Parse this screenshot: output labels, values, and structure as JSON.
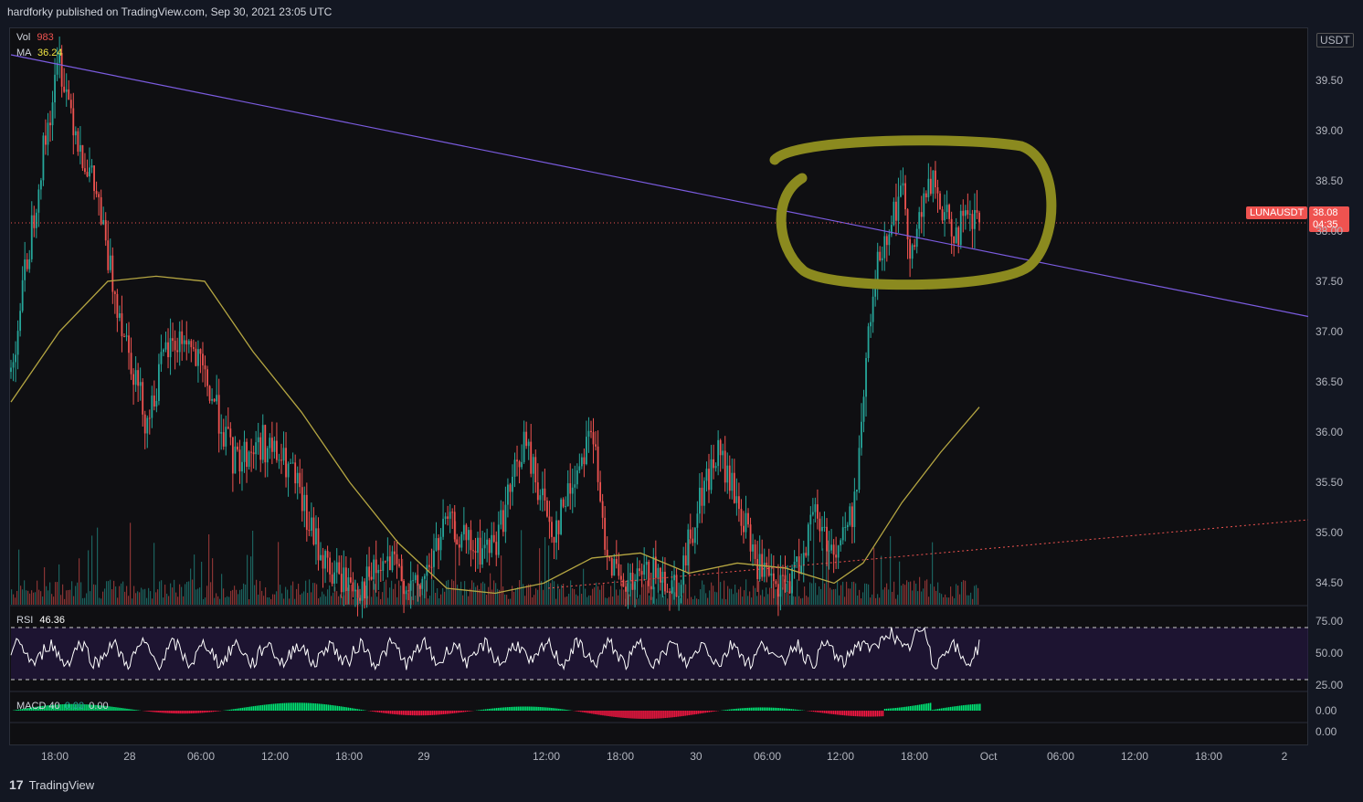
{
  "header": {
    "text": "hardforky published on TradingView.com, Sep 30, 2021 23:05 UTC"
  },
  "footer": {
    "logo": "17",
    "brand": "TradingView"
  },
  "currency": "USDT",
  "symbol": {
    "name": "LUNAUSDT",
    "price": "38.08",
    "timer": "04:35"
  },
  "legends": {
    "vol_label": "Vol",
    "vol_value": "983",
    "ma_label": "MA",
    "ma_value": "36.24",
    "rsi_label": "RSI",
    "rsi_value": "46.36",
    "macd_label": "MACD 40",
    "macd_value1": "0.00",
    "macd_value2": "0.00"
  },
  "colors": {
    "up": "#26a69a",
    "down": "#ef5350",
    "trend": "#7b5ce0",
    "ma": "#b5a642",
    "annotation": "#8b8a1f",
    "rsi": "#ffffff"
  },
  "chart_data": {
    "type": "line",
    "title": "",
    "price_axis": {
      "ticks": [
        "39.50",
        "39.00",
        "38.50",
        "38.00",
        "37.50",
        "37.00",
        "36.50",
        "36.00",
        "35.50",
        "35.00",
        "34.50"
      ],
      "ylim": [
        34.35,
        39.75
      ]
    },
    "rsi_axis": {
      "ticks": [
        "75.00",
        "50.00",
        "25.00"
      ]
    },
    "macd_axis": {
      "ticks": [
        "0.00",
        "0.00"
      ]
    },
    "time_axis": {
      "ticks": [
        "18:00",
        "28",
        "06:00",
        "12:00",
        "18:00",
        "29",
        "12:00",
        "18:00",
        "30",
        "06:00",
        "12:00",
        "18:00",
        "Oct",
        "06:00",
        "12:00",
        "18:00",
        "2"
      ]
    },
    "price_path": [
      {
        "t": 0,
        "v": 36.6
      },
      {
        "t": 0.03,
        "v": 38.6
      },
      {
        "t": 0.05,
        "v": 39.7
      },
      {
        "t": 0.07,
        "v": 38.9
      },
      {
        "t": 0.09,
        "v": 38.3
      },
      {
        "t": 0.1,
        "v": 37.7
      },
      {
        "t": 0.12,
        "v": 36.9
      },
      {
        "t": 0.14,
        "v": 36.1
      },
      {
        "t": 0.16,
        "v": 36.8
      },
      {
        "t": 0.18,
        "v": 36.95
      },
      {
        "t": 0.21,
        "v": 36.3
      },
      {
        "t": 0.23,
        "v": 35.7
      },
      {
        "t": 0.26,
        "v": 35.9
      },
      {
        "t": 0.29,
        "v": 35.6
      },
      {
        "t": 0.31,
        "v": 35.0
      },
      {
        "t": 0.33,
        "v": 34.6
      },
      {
        "t": 0.36,
        "v": 34.45
      },
      {
        "t": 0.39,
        "v": 34.7
      },
      {
        "t": 0.42,
        "v": 34.4
      },
      {
        "t": 0.45,
        "v": 35.1
      },
      {
        "t": 0.48,
        "v": 34.8
      },
      {
        "t": 0.5,
        "v": 34.9
      },
      {
        "t": 0.53,
        "v": 35.9
      },
      {
        "t": 0.56,
        "v": 35.0
      },
      {
        "t": 0.58,
        "v": 35.5
      },
      {
        "t": 0.6,
        "v": 36.1
      },
      {
        "t": 0.61,
        "v": 35.1
      },
      {
        "t": 0.63,
        "v": 34.4
      },
      {
        "t": 0.66,
        "v": 34.6
      },
      {
        "t": 0.69,
        "v": 34.5
      },
      {
        "t": 0.71,
        "v": 35.3
      },
      {
        "t": 0.73,
        "v": 35.8
      },
      {
        "t": 0.75,
        "v": 35.3
      },
      {
        "t": 0.77,
        "v": 34.7
      },
      {
        "t": 0.79,
        "v": 34.4
      },
      {
        "t": 0.81,
        "v": 34.6
      },
      {
        "t": 0.83,
        "v": 35.2
      },
      {
        "t": 0.85,
        "v": 34.8
      },
      {
        "t": 0.87,
        "v": 35.2
      },
      {
        "t": 0.88,
        "v": 36.3
      },
      {
        "t": 0.89,
        "v": 37.4
      },
      {
        "t": 0.9,
        "v": 37.9
      },
      {
        "t": 0.92,
        "v": 38.4
      },
      {
        "t": 0.93,
        "v": 37.8
      },
      {
        "t": 0.95,
        "v": 38.5
      },
      {
        "t": 0.97,
        "v": 38.0
      },
      {
        "t": 1.0,
        "v": 38.1
      }
    ],
    "ma_path": [
      {
        "t": 0,
        "v": 36.3
      },
      {
        "t": 0.05,
        "v": 37.0
      },
      {
        "t": 0.1,
        "v": 37.5
      },
      {
        "t": 0.15,
        "v": 37.55
      },
      {
        "t": 0.2,
        "v": 37.5
      },
      {
        "t": 0.25,
        "v": 36.8
      },
      {
        "t": 0.3,
        "v": 36.2
      },
      {
        "t": 0.35,
        "v": 35.5
      },
      {
        "t": 0.4,
        "v": 34.9
      },
      {
        "t": 0.45,
        "v": 34.45
      },
      {
        "t": 0.5,
        "v": 34.4
      },
      {
        "t": 0.55,
        "v": 34.5
      },
      {
        "t": 0.6,
        "v": 34.75
      },
      {
        "t": 0.65,
        "v": 34.8
      },
      {
        "t": 0.7,
        "v": 34.6
      },
      {
        "t": 0.75,
        "v": 34.7
      },
      {
        "t": 0.8,
        "v": 34.65
      },
      {
        "t": 0.85,
        "v": 34.5
      },
      {
        "t": 0.88,
        "v": 34.7
      },
      {
        "t": 0.92,
        "v": 35.3
      },
      {
        "t": 0.96,
        "v": 35.8
      },
      {
        "t": 1.0,
        "v": 36.25
      }
    ]
  }
}
